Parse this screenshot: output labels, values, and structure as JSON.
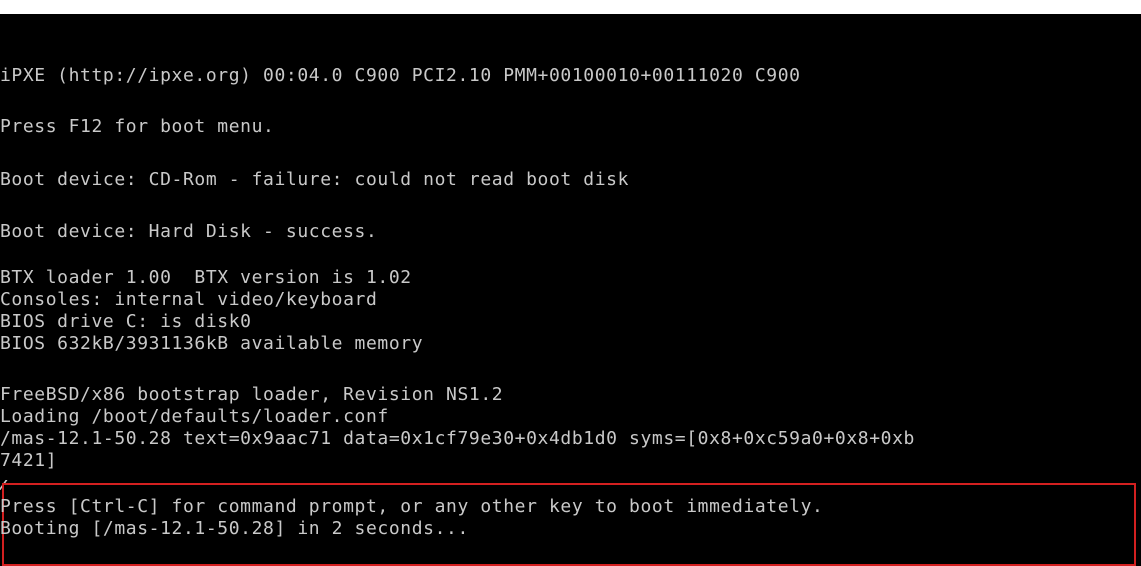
{
  "console": {
    "lines": [
      "iPXE (http://ipxe.org) 00:04.0 C900 PCI2.10 PMM+00100010+00111020 C900",
      "Press F12 for boot menu.",
      "Boot device: CD-Rom - failure: could not read boot disk",
      "Boot device: Hard Disk - success.",
      "BTX loader 1.00  BTX version is 1.02",
      "Consoles: internal video/keyboard",
      "BIOS drive C: is disk0",
      "BIOS 632kB/3931136kB available memory",
      "FreeBSD/x86 bootstrap loader, Revision NS1.2",
      "Loading /boot/defaults/loader.conf",
      "/mas-12.1-50.28 text=0x9aac71 data=0x1cf79e30+0x4db1d0 syms=[0x8+0xc59a0+0x8+0xb",
      "7421]",
      "Press [Ctrl-C] for command prompt, or any other key to boot immediately.",
      "Booting [/mas-12.1-50.28] in 2 seconds..."
    ]
  },
  "colors": {
    "background": "#000000",
    "text": "#c9c9c9",
    "highlight_border": "#d32020"
  }
}
